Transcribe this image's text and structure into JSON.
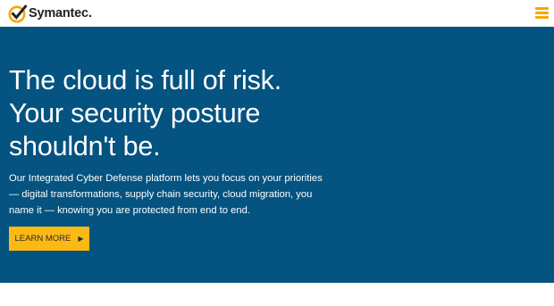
{
  "header": {
    "logo_text": "Symantec",
    "logo_suffix": ".",
    "menu_icon": "hamburger-menu-icon",
    "accent_color": "#f5a800"
  },
  "hero": {
    "background_color": "#045380",
    "title_lines": [
      "The cloud is full of risk.",
      "Your security posture",
      "shouldn't be."
    ],
    "description_lines": [
      "Our Integrated Cyber Defense platform lets you focus on your priorities",
      "— digital transformations, supply chain security, cloud migration, you",
      "name it — knowing you are protected from end to end."
    ],
    "cta": {
      "label": "LEARN MORE",
      "icon": "play-arrow-icon",
      "arrow": "▶",
      "color": "#fdb913"
    }
  }
}
